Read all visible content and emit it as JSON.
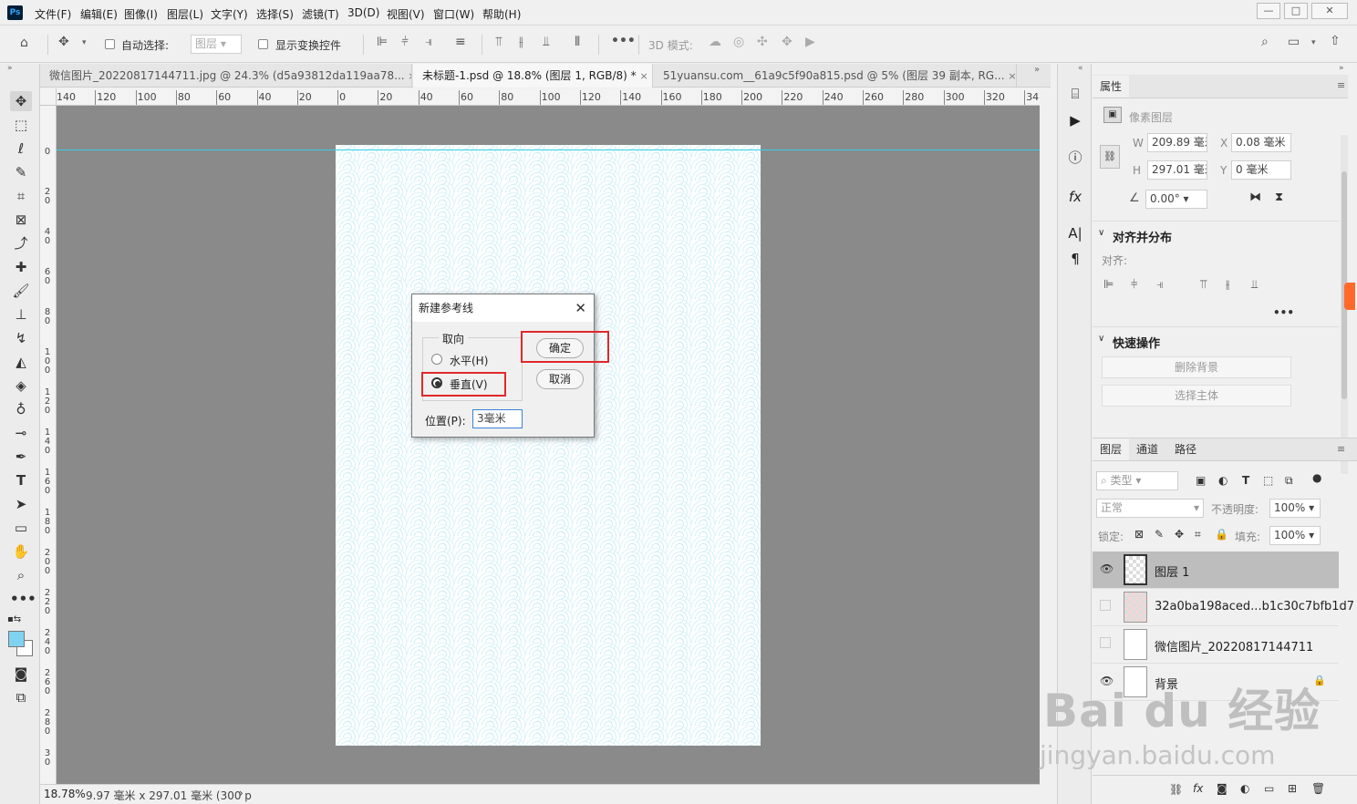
{
  "menubar": {
    "logo": "Ps",
    "items": [
      "文件(F)",
      "编辑(E)",
      "图像(I)",
      "图层(L)",
      "文字(Y)",
      "选择(S)",
      "滤镜(T)",
      "3D(D)",
      "视图(V)",
      "窗口(W)",
      "帮助(H)"
    ]
  },
  "options": {
    "auto_select_label": "自动选择:",
    "layer_select": "图层",
    "show_transform_label": "显示变换控件",
    "mode_3d_label": "3D 模式:"
  },
  "tabs": [
    {
      "label": "微信图片_20220817144711.jpg @ 24.3% (d5a93812da119aa78...",
      "close": "×"
    },
    {
      "label": "未标题-1.psd @ 18.8% (图层 1, RGB/8) *",
      "close": "×"
    },
    {
      "label": "51yuansu.com__61a9c5f90a815.psd @ 5% (图层 39 副本, RG...",
      "close": "×"
    }
  ],
  "ruler": {
    "h": [
      "140",
      "120",
      "100",
      "80",
      "60",
      "40",
      "20",
      "0",
      "20",
      "40",
      "60",
      "80",
      "100",
      "120",
      "140",
      "160",
      "180",
      "200",
      "220",
      "240",
      "260",
      "280",
      "300",
      "320",
      "34"
    ],
    "v": [
      "0",
      "20",
      "40",
      "60",
      "80",
      "100",
      "120",
      "140",
      "160",
      "180",
      "200",
      "220",
      "240",
      "260",
      "280",
      "30"
    ]
  },
  "status": {
    "zoom": "18.78%",
    "info": "9.97 毫米 x 297.01 毫米 (300 p"
  },
  "dialog": {
    "title": "新建参考线",
    "close": "✕",
    "group_label": "取向",
    "horizontal": "水平(H)",
    "vertical": "垂直(V)",
    "selected": "vertical",
    "position_label": "位置(P):",
    "position_value": "3毫米",
    "ok": "确定",
    "cancel": "取消"
  },
  "properties": {
    "tab": "属性",
    "kind": "像素图层",
    "w_label": "W",
    "w_value": "209.89 毫米",
    "x_label": "X",
    "x_value": "0.08 毫米",
    "h_label": "H",
    "h_value": "297.01 毫米",
    "y_label": "Y",
    "y_value": "0 毫米",
    "angle": "0.00°",
    "align_section": "对齐并分布",
    "align_label": "对齐:",
    "quick_section": "快速操作",
    "remove_bg": "删除背景",
    "select_subject": "选择主体",
    "more": "•••"
  },
  "layers": {
    "tabs": [
      "图层",
      "通道",
      "路径"
    ],
    "filter": "类型",
    "blend": "正常",
    "opacity_label": "不透明度:",
    "opacity": "100%",
    "lock_label": "锁定:",
    "fill_label": "填充:",
    "fill": "100%",
    "items": [
      {
        "name": "图层 1",
        "visible": true,
        "selected": true
      },
      {
        "name": "32a0ba198aced...b1c30c7bfb1d7",
        "visible": false,
        "selected": false
      },
      {
        "name": "微信图片_20220817144711",
        "visible": false,
        "selected": false
      },
      {
        "name": "背景",
        "visible": true,
        "selected": false
      }
    ]
  },
  "watermark": {
    "text": "Bai du 经验",
    "sub": "jingyan.baidu.com"
  },
  "colors": {
    "guide": "#35d0ea",
    "highlight": "#e0282a",
    "foreground": "#7fd3f0"
  }
}
